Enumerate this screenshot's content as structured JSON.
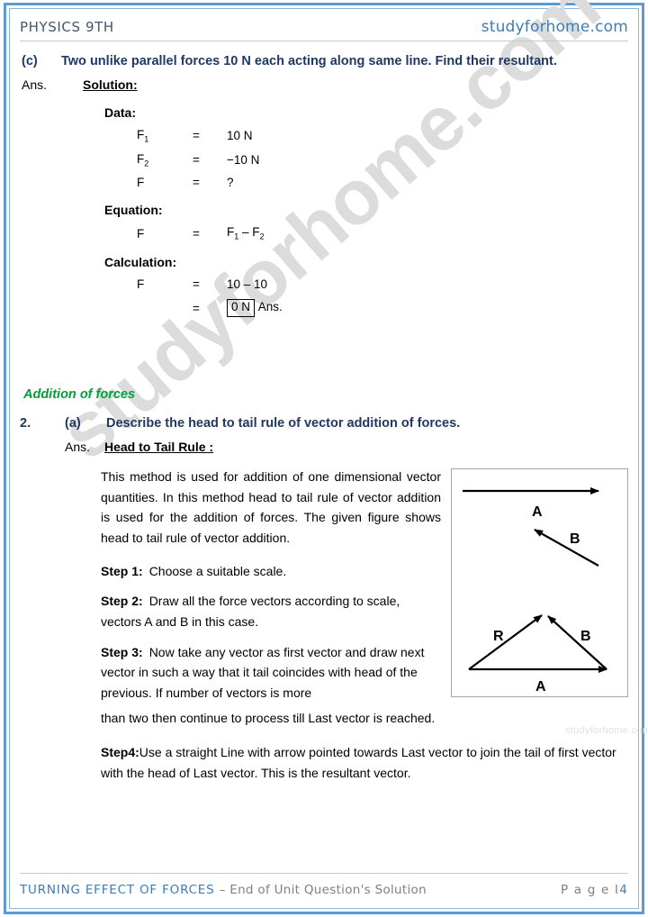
{
  "header": {
    "subject": "PHYSICS 9TH",
    "site": "studyforhome.com"
  },
  "watermark": {
    "big": "studyforhome.com",
    "small": "studyforhome.com"
  },
  "question_c": {
    "part": "(c)",
    "text": "Two unlike parallel forces 10 N each acting along same line. Find their resultant.",
    "ans_label": "Ans.",
    "ans_heading": "Solution:",
    "data_heading": "Data:",
    "data_rows": [
      {
        "symbol": "F",
        "sub": "1",
        "eq": "=",
        "value": "10 N"
      },
      {
        "symbol": "F",
        "sub": "2",
        "eq": "=",
        "value": "−10 N"
      },
      {
        "symbol": "F",
        "sub": "",
        "eq": "=",
        "value": "?"
      }
    ],
    "equation_heading": "Equation:",
    "equation_row": {
      "symbol": "F",
      "eq": "=",
      "value_pre": "F",
      "value_sub1": "1",
      "value_mid": " – F",
      "value_sub2": "2"
    },
    "calculation_heading": "Calculation:",
    "calc_rows": [
      {
        "symbol": "F",
        "eq": "=",
        "value": "10 – 10"
      },
      {
        "symbol": "",
        "eq": "=",
        "boxed": "0 N",
        "suffix": "Ans."
      }
    ]
  },
  "section_heading": "Addition of forces",
  "question_2": {
    "number": "2.",
    "part": "(a)",
    "text": "Describe the head to tail rule of vector addition of forces.",
    "ans_label": "Ans.",
    "ans_heading": "Head to Tail Rule :",
    "paragraph": "This method is used for addition of one dimensional vector quantities. In this method head to tail rule of vector addition is used for the addition of forces. The given figure shows head to tail rule of vector addition.",
    "steps": [
      {
        "label": "Step 1:",
        "text": "Choose a suitable scale."
      },
      {
        "label": "Step 2:",
        "text": "Draw all the force vectors according to scale, vectors A and B in this case."
      },
      {
        "label": "Step 3:",
        "text": "Now take any vector as first vector and draw next vector in such a way that it tail coincides with head of the previous. If number of vectors is more"
      }
    ],
    "step3_tail": "than two then continue to process till Last vector is reached.",
    "step4": {
      "label": "Step4:",
      "text": "Use a straight Line with arrow pointed towards Last vector to join the tail of first vector with the head of Last vector. This is the resultant vector."
    }
  },
  "figure": {
    "labels": {
      "top_a": "A",
      "top_b": "B",
      "tri_r": "R",
      "tri_b": "B",
      "tri_a": "A"
    }
  },
  "footer": {
    "unit": "TURNING EFFECT OF FORCES",
    "subtitle": "– End of Unit Question's Solution",
    "page_label": "P a g e  I",
    "page_number": "4"
  }
}
